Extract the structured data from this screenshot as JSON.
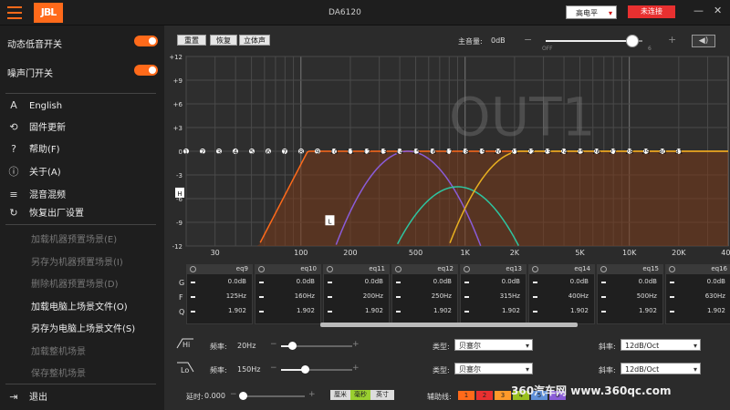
{
  "header": {
    "logo": "JBL",
    "title": "DA6120",
    "level": "高电平",
    "connect": "未连接",
    "minimize": "—",
    "close": "✕"
  },
  "sidebar": {
    "toggles": [
      {
        "label": "动态低音开关"
      },
      {
        "label": "噪声门开关"
      }
    ],
    "menu": [
      {
        "icon": "A",
        "label": "English"
      },
      {
        "icon": "⟲",
        "label": "固件更新"
      },
      {
        "icon": "?",
        "label": "帮助(F)"
      },
      {
        "icon": "ⓘ",
        "label": "关于(A)"
      },
      {
        "icon": "≡",
        "label": "混音混频"
      },
      {
        "icon": "↻",
        "label": "恢复出厂设置"
      }
    ],
    "sub": [
      {
        "label": "加载机器预置场景(E)",
        "dim": true
      },
      {
        "label": "另存为机器预置场景(I)",
        "dim": true
      },
      {
        "label": "删除机器预置场景(D)",
        "dim": true
      },
      {
        "label": "加载电脑上场景文件(O)",
        "dim": false
      },
      {
        "label": "另存为电脑上场景文件(S)",
        "dim": false
      },
      {
        "label": "加载整机场景",
        "dim": true
      },
      {
        "label": "保存整机场景",
        "dim": true
      }
    ],
    "exit": "退出"
  },
  "toolbar": {
    "buttons": [
      "重置",
      "恢复",
      "立体声"
    ],
    "volume_label": "主音量:",
    "volume_value": "0dB",
    "minus": "−",
    "plus": "+",
    "off": "OFF",
    "max": "6",
    "volume_fraction": 0.9
  },
  "chart_data": {
    "type": "line",
    "watermark": "OUT1",
    "ylim": [
      -12,
      12
    ],
    "y_ticks": [
      "+12",
      "+9",
      "+6",
      "+3",
      "0",
      "-3",
      "-6",
      "-9",
      "-12"
    ],
    "x_ticks": [
      "30",
      "100",
      "200",
      "500",
      "1K",
      "2K",
      "5K",
      "10K",
      "20K",
      "40K"
    ],
    "bands": [
      "1",
      "2",
      "3",
      "4",
      "5",
      "6",
      "7",
      "8",
      "9",
      "10",
      "11",
      "12",
      "13",
      "14",
      "15",
      "16",
      "17",
      "18",
      "19",
      "20",
      "21",
      "22",
      "23",
      "24",
      "25",
      "26",
      "27",
      "28",
      "29",
      "30",
      "31"
    ],
    "markers": [
      "H",
      "L"
    ],
    "colors": {
      "hp": "#ff6a1a",
      "lp": "#8a5cd8",
      "bp": "#2ec4a0",
      "hp2": "#e8b020",
      "fill": "#7a3a1a"
    }
  },
  "eq": {
    "rows": [
      "G",
      "F",
      "Q"
    ],
    "cards": [
      {
        "name": "eq9",
        "gain": "0.0dB",
        "freq": "125Hz",
        "q": "1.902"
      },
      {
        "name": "eq10",
        "gain": "0.0dB",
        "freq": "160Hz",
        "q": "1.902"
      },
      {
        "name": "eq11",
        "gain": "0.0dB",
        "freq": "200Hz",
        "q": "1.902"
      },
      {
        "name": "eq12",
        "gain": "0.0dB",
        "freq": "250Hz",
        "q": "1.902"
      },
      {
        "name": "eq13",
        "gain": "0.0dB",
        "freq": "315Hz",
        "q": "1.902"
      },
      {
        "name": "eq14",
        "gain": "0.0dB",
        "freq": "400Hz",
        "q": "1.902"
      },
      {
        "name": "eq15",
        "gain": "0.0dB",
        "freq": "500Hz",
        "q": "1.902"
      },
      {
        "name": "eq16",
        "gain": "0.0dB",
        "freq": "630Hz",
        "q": "1.902"
      }
    ]
  },
  "filters": [
    {
      "tag": "Hi",
      "freq_label": "频率:",
      "freq": "20Hz",
      "type_label": "类型:",
      "type": "贝塞尔",
      "slope_label": "斜率:",
      "slope": "12dB/Oct",
      "fraction": 0.16
    },
    {
      "tag": "Lo",
      "freq_label": "频率:",
      "freq": "150Hz",
      "type_label": "类型:",
      "type": "贝塞尔",
      "slope_label": "斜率:",
      "slope": "12dB/Oct",
      "fraction": 0.33
    }
  ],
  "delay": {
    "label": "延时:",
    "value": "0.000",
    "units": [
      "厘米",
      "毫秒",
      "英寸"
    ],
    "aux_label": "辅助线:",
    "aux": [
      "1",
      "2",
      "3",
      "4",
      "5",
      "6"
    ],
    "aux_colors": [
      "#ff6a1a",
      "#e83030",
      "#ff9a2a",
      "#9ac020",
      "#6090d8",
      "#8a5cd8"
    ]
  },
  "watermark": "360汽车网 www.360qc.com"
}
